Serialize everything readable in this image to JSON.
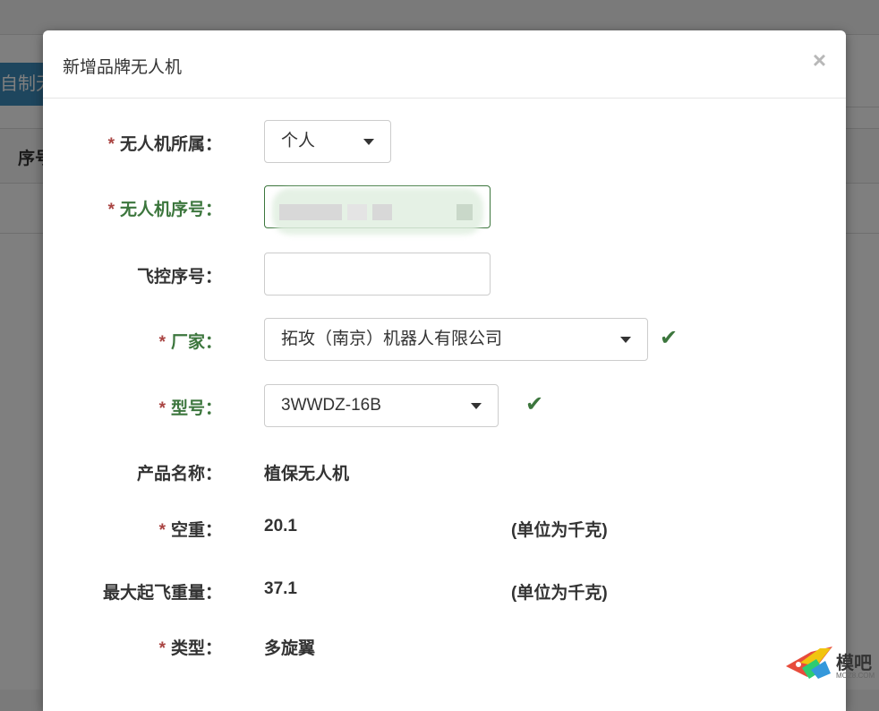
{
  "background": {
    "button_label": "自制无",
    "table_header_first": "序号"
  },
  "modal": {
    "title": "新增品牌无人机",
    "close_symbol": "×"
  },
  "form": {
    "owner": {
      "label": "无人机所属：",
      "required": true,
      "value": "个人"
    },
    "serial": {
      "label": "无人机序号：",
      "required": true,
      "value": ""
    },
    "fc_serial": {
      "label": "飞控序号：",
      "required": false,
      "value": ""
    },
    "manufacturer": {
      "label": "厂家：",
      "required": true,
      "value": "拓攻（南京）机器人有限公司",
      "valid": true
    },
    "model": {
      "label": "型号：",
      "required": true,
      "value": "3WWDZ-16B",
      "valid": true
    },
    "product_name": {
      "label": "产品名称：",
      "required": false,
      "value": "植保无人机"
    },
    "empty_weight": {
      "label": "空重：",
      "required": true,
      "value": "20.1",
      "unit": "(单位为千克)"
    },
    "max_takeoff_weight": {
      "label": "最大起飞重量：",
      "required": false,
      "value": "37.1",
      "unit": "(单位为千克)"
    },
    "type": {
      "label": "类型：",
      "required": true,
      "value": "多旋翼"
    }
  },
  "watermark": {
    "text": "模吧",
    "sub": "MOZ8.COM"
  },
  "colors": {
    "success": "#3c763d",
    "required": "#a94442",
    "primary": "#3c8dbc"
  }
}
